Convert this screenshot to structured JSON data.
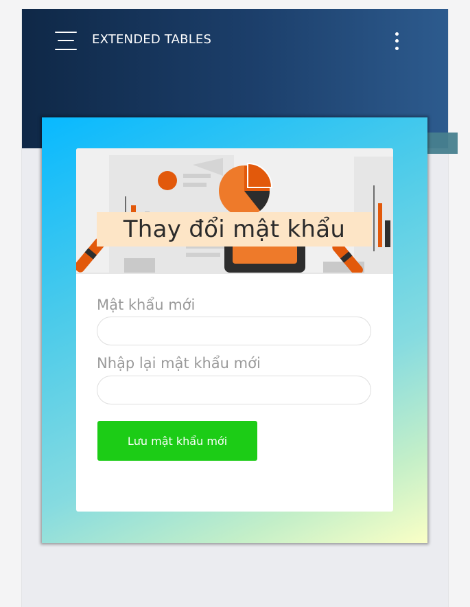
{
  "navbar": {
    "title": "EXTENDED TABLES",
    "menu_icon": "hamburger-menu-icon",
    "more_icon": "more-vertical-icon",
    "gradient": [
      "#0f2847",
      "#2d5b8e"
    ]
  },
  "card": {
    "banner_title": "Thay đổi mật khẩu",
    "fields": [
      {
        "label": "Mật khẩu mới",
        "value": "",
        "placeholder": ""
      },
      {
        "label": "Nhập lại mật khẩu mới",
        "value": "",
        "placeholder": ""
      }
    ],
    "save_label": "Lưu mật khẩu mới"
  },
  "colors": {
    "accent_button": "#1ccc16",
    "banner_title_bg": "#fde5c6",
    "panel_gradient": [
      "#08b9ff",
      "#faffc6"
    ]
  }
}
